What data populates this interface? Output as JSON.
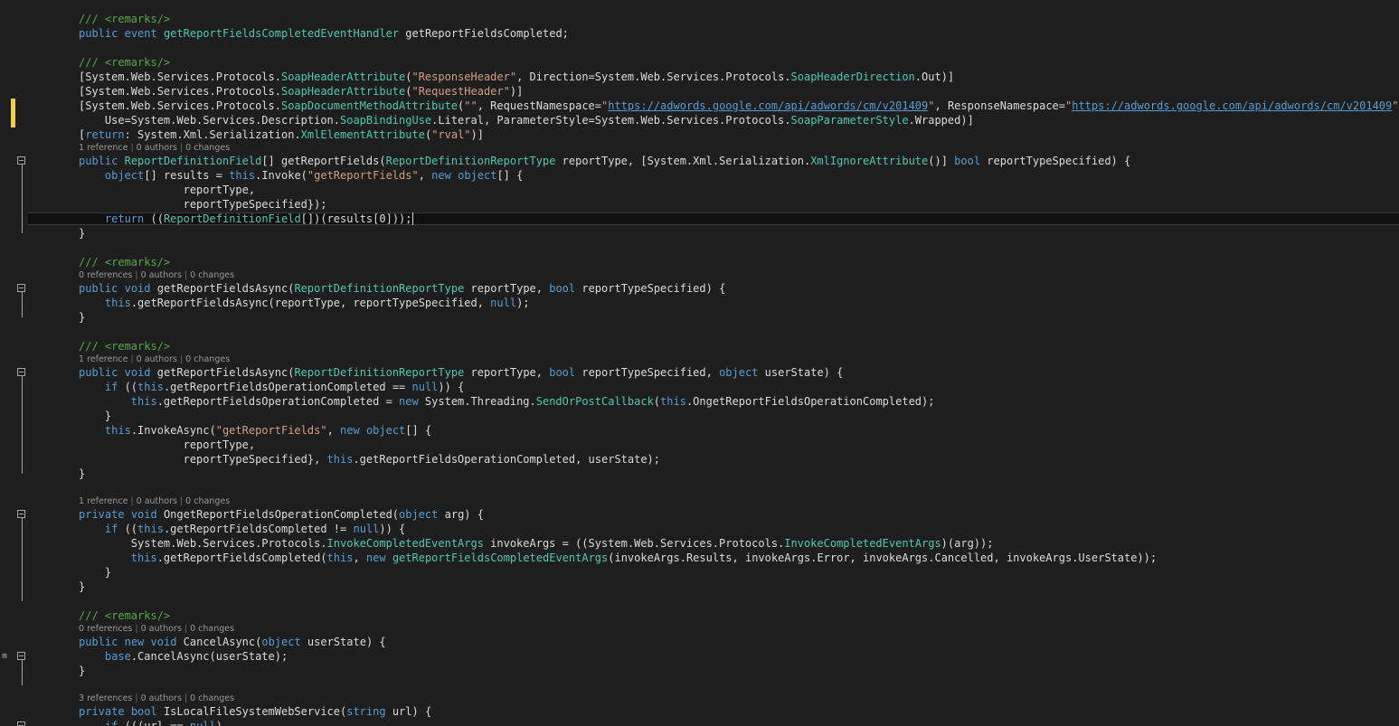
{
  "editor": {
    "colors": {
      "background": "#1e1e1e",
      "plain": "#dcdcdc",
      "keyword": "#569cd6",
      "type": "#4ec9b0",
      "string": "#d69d85",
      "comment": "#57a64a",
      "lens": "#999999",
      "change_marker": "#efce4a",
      "outline": "#a5a5a5"
    },
    "lines": [
      {
        "kind": "code",
        "indent": 0,
        "segments": [
          [
            "cm",
            "/// <remarks/>"
          ]
        ]
      },
      {
        "kind": "code",
        "indent": 0,
        "segments": [
          [
            "kw",
            "public"
          ],
          [
            "tx",
            " "
          ],
          [
            "kw",
            "event"
          ],
          [
            "tx",
            " "
          ],
          [
            "ty",
            "getReportFieldsCompletedEventHandler"
          ],
          [
            "tx",
            " getReportFieldsCompleted;"
          ]
        ]
      },
      {
        "kind": "blank"
      },
      {
        "kind": "code",
        "indent": 0,
        "segments": [
          [
            "cm",
            "/// <remarks/>"
          ]
        ]
      },
      {
        "kind": "code",
        "indent": 0,
        "segments": [
          [
            "tx",
            "[System.Web.Services.Protocols."
          ],
          [
            "ty",
            "SoapHeaderAttribute"
          ],
          [
            "tx",
            "("
          ],
          [
            "st",
            "\"ResponseHeader\""
          ],
          [
            "tx",
            ", Direction=System.Web.Services.Protocols."
          ],
          [
            "ty",
            "SoapHeaderDirection"
          ],
          [
            "tx",
            ".Out)]"
          ]
        ]
      },
      {
        "kind": "code",
        "indent": 0,
        "segments": [
          [
            "tx",
            "[System.Web.Services.Protocols."
          ],
          [
            "ty",
            "SoapHeaderAttribute"
          ],
          [
            "tx",
            "("
          ],
          [
            "st",
            "\"RequestHeader\""
          ],
          [
            "tx",
            ")]"
          ]
        ]
      },
      {
        "kind": "code",
        "indent": 0,
        "segments": [
          [
            "tx",
            "[System.Web.Services.Protocols."
          ],
          [
            "ty",
            "SoapDocumentMethodAttribute"
          ],
          [
            "tx",
            "("
          ],
          [
            "st",
            "\"\""
          ],
          [
            "tx",
            ", RequestNamespace="
          ],
          [
            "st",
            "\""
          ],
          [
            "ln",
            "https://adwords.google.com/api/adwords/cm/v201409"
          ],
          [
            "st",
            "\""
          ],
          [
            "tx",
            ", ResponseNamespace="
          ],
          [
            "st",
            "\""
          ],
          [
            "ln",
            "https://adwords.google.com/api/adwords/cm/v201409"
          ],
          [
            "st",
            "\""
          ],
          [
            "tx",
            ","
          ]
        ]
      },
      {
        "kind": "code",
        "indent": 1,
        "segments": [
          [
            "tx",
            "Use=System.Web.Services.Description."
          ],
          [
            "ty",
            "SoapBindingUse"
          ],
          [
            "tx",
            ".Literal, ParameterStyle=System.Web.Services.Protocols."
          ],
          [
            "ty",
            "SoapParameterStyle"
          ],
          [
            "tx",
            ".Wrapped)]"
          ]
        ]
      },
      {
        "kind": "code",
        "indent": 0,
        "segments": [
          [
            "tx",
            "["
          ],
          [
            "kw",
            "return"
          ],
          [
            "tx",
            ": System.Xml.Serialization."
          ],
          [
            "ty",
            "XmlElementAttribute"
          ],
          [
            "tx",
            "("
          ],
          [
            "st",
            "\"rval\""
          ],
          [
            "tx",
            ")]"
          ]
        ]
      },
      {
        "kind": "lens",
        "refs": "1 reference",
        "authors": "0 authors",
        "changes": "0 changes"
      },
      {
        "kind": "code",
        "indent": 0,
        "segments": [
          [
            "kw",
            "public"
          ],
          [
            "tx",
            " "
          ],
          [
            "ty",
            "ReportDefinitionField"
          ],
          [
            "tx",
            "[] getReportFields("
          ],
          [
            "ty",
            "ReportDefinitionReportType"
          ],
          [
            "tx",
            " reportType, [System.Xml.Serialization."
          ],
          [
            "ty",
            "XmlIgnoreAttribute"
          ],
          [
            "tx",
            "()] "
          ],
          [
            "kw",
            "bool"
          ],
          [
            "tx",
            " reportTypeSpecified) {"
          ]
        ]
      },
      {
        "kind": "code",
        "indent": 1,
        "segments": [
          [
            "kw",
            "object"
          ],
          [
            "tx",
            "[] results = "
          ],
          [
            "kw",
            "this"
          ],
          [
            "tx",
            ".Invoke("
          ],
          [
            "st",
            "\"getReportFields\""
          ],
          [
            "tx",
            ", "
          ],
          [
            "kw",
            "new"
          ],
          [
            "tx",
            " "
          ],
          [
            "kw",
            "object"
          ],
          [
            "tx",
            "[] {"
          ]
        ]
      },
      {
        "kind": "code",
        "indent": 4,
        "segments": [
          [
            "tx",
            "reportType,"
          ]
        ]
      },
      {
        "kind": "code",
        "indent": 4,
        "segments": [
          [
            "tx",
            "reportTypeSpecified});"
          ]
        ]
      },
      {
        "kind": "code",
        "indent": 1,
        "segments": [
          [
            "kw",
            "return"
          ],
          [
            "tx",
            " (("
          ],
          [
            "ty",
            "ReportDefinitionField"
          ],
          [
            "tx",
            "[])(results[0]));"
          ]
        ]
      },
      {
        "kind": "code",
        "indent": 0,
        "segments": [
          [
            "tx",
            "}"
          ]
        ]
      },
      {
        "kind": "blank"
      },
      {
        "kind": "code",
        "indent": 0,
        "segments": [
          [
            "cm",
            "/// <remarks/>"
          ]
        ]
      },
      {
        "kind": "lens",
        "refs": "0 references",
        "authors": "0 authors",
        "changes": "0 changes"
      },
      {
        "kind": "code",
        "indent": 0,
        "segments": [
          [
            "kw",
            "public"
          ],
          [
            "tx",
            " "
          ],
          [
            "kw",
            "void"
          ],
          [
            "tx",
            " getReportFieldsAsync("
          ],
          [
            "ty",
            "ReportDefinitionReportType"
          ],
          [
            "tx",
            " reportType, "
          ],
          [
            "kw",
            "bool"
          ],
          [
            "tx",
            " reportTypeSpecified) {"
          ]
        ]
      },
      {
        "kind": "code",
        "indent": 1,
        "segments": [
          [
            "kw",
            "this"
          ],
          [
            "tx",
            ".getReportFieldsAsync(reportType, reportTypeSpecified, "
          ],
          [
            "kw",
            "null"
          ],
          [
            "tx",
            ");"
          ]
        ]
      },
      {
        "kind": "code",
        "indent": 0,
        "segments": [
          [
            "tx",
            "}"
          ]
        ]
      },
      {
        "kind": "blank"
      },
      {
        "kind": "code",
        "indent": 0,
        "segments": [
          [
            "cm",
            "/// <remarks/>"
          ]
        ]
      },
      {
        "kind": "lens",
        "refs": "1 reference",
        "authors": "0 authors",
        "changes": "0 changes"
      },
      {
        "kind": "code",
        "indent": 0,
        "segments": [
          [
            "kw",
            "public"
          ],
          [
            "tx",
            " "
          ],
          [
            "kw",
            "void"
          ],
          [
            "tx",
            " getReportFieldsAsync("
          ],
          [
            "ty",
            "ReportDefinitionReportType"
          ],
          [
            "tx",
            " reportType, "
          ],
          [
            "kw",
            "bool"
          ],
          [
            "tx",
            " reportTypeSpecified, "
          ],
          [
            "kw",
            "object"
          ],
          [
            "tx",
            " userState) {"
          ]
        ]
      },
      {
        "kind": "code",
        "indent": 1,
        "segments": [
          [
            "kw",
            "if"
          ],
          [
            "tx",
            " (("
          ],
          [
            "kw",
            "this"
          ],
          [
            "tx",
            ".getReportFieldsOperationCompleted == "
          ],
          [
            "kw",
            "null"
          ],
          [
            "tx",
            ")) {"
          ]
        ]
      },
      {
        "kind": "code",
        "indent": 2,
        "segments": [
          [
            "kw",
            "this"
          ],
          [
            "tx",
            ".getReportFieldsOperationCompleted = "
          ],
          [
            "kw",
            "new"
          ],
          [
            "tx",
            " System.Threading."
          ],
          [
            "ty",
            "SendOrPostCallback"
          ],
          [
            "tx",
            "("
          ],
          [
            "kw",
            "this"
          ],
          [
            "tx",
            ".OngetReportFieldsOperationCompleted);"
          ]
        ]
      },
      {
        "kind": "code",
        "indent": 1,
        "segments": [
          [
            "tx",
            "}"
          ]
        ]
      },
      {
        "kind": "code",
        "indent": 1,
        "segments": [
          [
            "kw",
            "this"
          ],
          [
            "tx",
            ".InvokeAsync("
          ],
          [
            "st",
            "\"getReportFields\""
          ],
          [
            "tx",
            ", "
          ],
          [
            "kw",
            "new"
          ],
          [
            "tx",
            " "
          ],
          [
            "kw",
            "object"
          ],
          [
            "tx",
            "[] {"
          ]
        ]
      },
      {
        "kind": "code",
        "indent": 4,
        "segments": [
          [
            "tx",
            "reportType,"
          ]
        ]
      },
      {
        "kind": "code",
        "indent": 4,
        "segments": [
          [
            "tx",
            "reportTypeSpecified}, "
          ],
          [
            "kw",
            "this"
          ],
          [
            "tx",
            ".getReportFieldsOperationCompleted, userState);"
          ]
        ]
      },
      {
        "kind": "code",
        "indent": 0,
        "segments": [
          [
            "tx",
            "}"
          ]
        ]
      },
      {
        "kind": "blank"
      },
      {
        "kind": "lens",
        "refs": "1 reference",
        "authors": "0 authors",
        "changes": "0 changes"
      },
      {
        "kind": "code",
        "indent": 0,
        "segments": [
          [
            "kw",
            "private"
          ],
          [
            "tx",
            " "
          ],
          [
            "kw",
            "void"
          ],
          [
            "tx",
            " OngetReportFieldsOperationCompleted("
          ],
          [
            "kw",
            "object"
          ],
          [
            "tx",
            " arg) {"
          ]
        ]
      },
      {
        "kind": "code",
        "indent": 1,
        "segments": [
          [
            "kw",
            "if"
          ],
          [
            "tx",
            " (("
          ],
          [
            "kw",
            "this"
          ],
          [
            "tx",
            ".getReportFieldsCompleted != "
          ],
          [
            "kw",
            "null"
          ],
          [
            "tx",
            ")) {"
          ]
        ]
      },
      {
        "kind": "code",
        "indent": 2,
        "segments": [
          [
            "tx",
            "System.Web.Services.Protocols."
          ],
          [
            "ty",
            "InvokeCompletedEventArgs"
          ],
          [
            "tx",
            " invokeArgs = ((System.Web.Services.Protocols."
          ],
          [
            "ty",
            "InvokeCompletedEventArgs"
          ],
          [
            "tx",
            ")(arg));"
          ]
        ]
      },
      {
        "kind": "code",
        "indent": 2,
        "segments": [
          [
            "kw",
            "this"
          ],
          [
            "tx",
            ".getReportFieldsCompleted("
          ],
          [
            "kw",
            "this"
          ],
          [
            "tx",
            ", "
          ],
          [
            "kw",
            "new"
          ],
          [
            "tx",
            " "
          ],
          [
            "ty",
            "getReportFieldsCompletedEventArgs"
          ],
          [
            "tx",
            "(invokeArgs.Results, invokeArgs.Error, invokeArgs.Cancelled, invokeArgs.UserState));"
          ]
        ]
      },
      {
        "kind": "code",
        "indent": 1,
        "segments": [
          [
            "tx",
            "}"
          ]
        ]
      },
      {
        "kind": "code",
        "indent": 0,
        "segments": [
          [
            "tx",
            "}"
          ]
        ]
      },
      {
        "kind": "blank"
      },
      {
        "kind": "code",
        "indent": 0,
        "segments": [
          [
            "cm",
            "/// <remarks/>"
          ]
        ]
      },
      {
        "kind": "lens",
        "refs": "0 references",
        "authors": "0 authors",
        "changes": "0 changes"
      },
      {
        "kind": "code",
        "indent": 0,
        "segments": [
          [
            "kw",
            "public"
          ],
          [
            "tx",
            " "
          ],
          [
            "kw",
            "new"
          ],
          [
            "tx",
            " "
          ],
          [
            "kw",
            "void"
          ],
          [
            "tx",
            " CancelAsync("
          ],
          [
            "kw",
            "object"
          ],
          [
            "tx",
            " userState) {"
          ]
        ]
      },
      {
        "kind": "code",
        "indent": 1,
        "segments": [
          [
            "kw",
            "base"
          ],
          [
            "tx",
            ".CancelAsync(userState);"
          ]
        ]
      },
      {
        "kind": "code",
        "indent": 0,
        "segments": [
          [
            "tx",
            "}"
          ]
        ]
      },
      {
        "kind": "blank"
      },
      {
        "kind": "lens",
        "refs": "3 references",
        "authors": "0 authors",
        "changes": "0 changes"
      },
      {
        "kind": "code",
        "indent": 0,
        "segments": [
          [
            "kw",
            "private"
          ],
          [
            "tx",
            " "
          ],
          [
            "kw",
            "bool"
          ],
          [
            "tx",
            " IsLocalFileSystemWebService("
          ],
          [
            "kw",
            "string"
          ],
          [
            "tx",
            " url) {"
          ]
        ]
      },
      {
        "kind": "code",
        "indent": 1,
        "segments": [
          [
            "kw",
            "if"
          ],
          [
            "tx",
            " (((url == "
          ],
          [
            "kw",
            "null"
          ],
          [
            "tx",
            ")"
          ]
        ]
      }
    ]
  }
}
